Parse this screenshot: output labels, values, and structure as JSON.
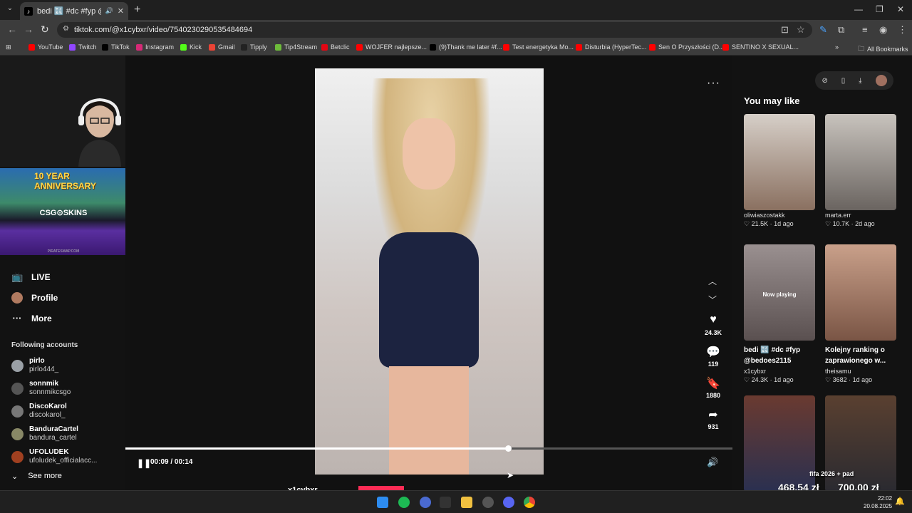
{
  "browser": {
    "tab_title": "bedi 🔣 #dc #fyp @bedoes",
    "url": "tiktok.com/@x1cybxr/video/7540230290535484694",
    "bookmarks": [
      {
        "label": "YouTube",
        "color": "#ff0000"
      },
      {
        "label": "Twitch",
        "color": "#9146ff"
      },
      {
        "label": "TikTok",
        "color": "#000000"
      },
      {
        "label": "Instagram",
        "color": "#d62976"
      },
      {
        "label": "Kick",
        "color": "#53fc18"
      },
      {
        "label": "Gmail",
        "color": "#ea4335"
      },
      {
        "label": "Tipply",
        "color": "#222222"
      },
      {
        "label": "Tip4Stream",
        "color": "#6dbb3a"
      },
      {
        "label": "Betclic",
        "color": "#e30613"
      },
      {
        "label": "WOJFER najlepsze...",
        "color": "#ff0000"
      },
      {
        "label": "(9)Thank me later #f...",
        "color": "#000000"
      },
      {
        "label": "Test energetyka Mo...",
        "color": "#ff0000"
      },
      {
        "label": "Disturbia (HyperTec...",
        "color": "#ff0000"
      },
      {
        "label": "Sen O Przyszłości (D...",
        "color": "#ff0000"
      },
      {
        "label": "SENTINO X SEXUAL...",
        "color": "#ff0000"
      }
    ],
    "all_bookmarks": "All Bookmarks"
  },
  "ad": {
    "anniversary": "10 YEAR ANNIVERSARY",
    "brand": "CSG⊙SKINS",
    "footer": "PIRATESWAP.COM"
  },
  "sidebar": {
    "nav": [
      {
        "label": "LIVE",
        "icon": "📺"
      },
      {
        "label": "Profile",
        "icon": "●"
      },
      {
        "label": "More",
        "icon": "···"
      }
    ],
    "following_header": "Following accounts",
    "accounts": [
      {
        "name": "pirlo",
        "handle": "pirlo444_"
      },
      {
        "name": "sonnmik",
        "handle": "sonnmikcsgo"
      },
      {
        "name": "DiscoKarol",
        "handle": "discokarol_"
      },
      {
        "name": "BanduraCartel",
        "handle": "bandura_cartel"
      },
      {
        "name": "UFOLUDEK",
        "handle": "ufoludek_officialacc..."
      }
    ],
    "see_more": "See more"
  },
  "player": {
    "likes": "24.3K",
    "comments": "119",
    "saves": "1880",
    "shares": "931",
    "time": "00:09 / 00:14",
    "progress": 0.63,
    "author_below": "x1cybxr"
  },
  "right": {
    "header": "You may like",
    "cards": [
      {
        "title": "",
        "author": "oliwiaszostakk",
        "likes": "21.5K",
        "ago": "1d ago",
        "bg": "linear-gradient(180deg,#d6cfc8,#8a7060)",
        "now_playing": ""
      },
      {
        "title": "",
        "author": "marta.err",
        "likes": "10.7K",
        "ago": "2d ago",
        "bg": "linear-gradient(180deg,#c8c3bd,#6a6460)",
        "now_playing": ""
      },
      {
        "title": "bedi 🔣 #dc #fyp @bedoes2115",
        "author": "x1cybxr",
        "likes": "24.3K",
        "ago": "1d ago",
        "bg": "linear-gradient(180deg,#9a9090,#5a5050)",
        "now_playing": "Now playing"
      },
      {
        "title": "Kolejny ranking o zaprawionego w...",
        "author": "theisamu",
        "likes": "3682",
        "ago": "1d ago",
        "bg": "linear-gradient(180deg,#c9a08a,#7a5545)",
        "now_playing": ""
      },
      {
        "title": "",
        "author": "",
        "likes": "",
        "ago": "",
        "bg": "linear-gradient(180deg,#6a3a30,#2a3050)",
        "now_playing": ""
      },
      {
        "title": "",
        "author": "",
        "likes": "",
        "ago": "",
        "bg": "linear-gradient(180deg,#5a4030,#2a2a30)",
        "now_playing": ""
      }
    ]
  },
  "overlay": {
    "fifa": "fifa 2026 + pad",
    "left_amount": "468,54 zł",
    "right_amount": "700,00 zł"
  },
  "taskbar": {
    "time": "22:02",
    "date": "20.08.2025"
  }
}
